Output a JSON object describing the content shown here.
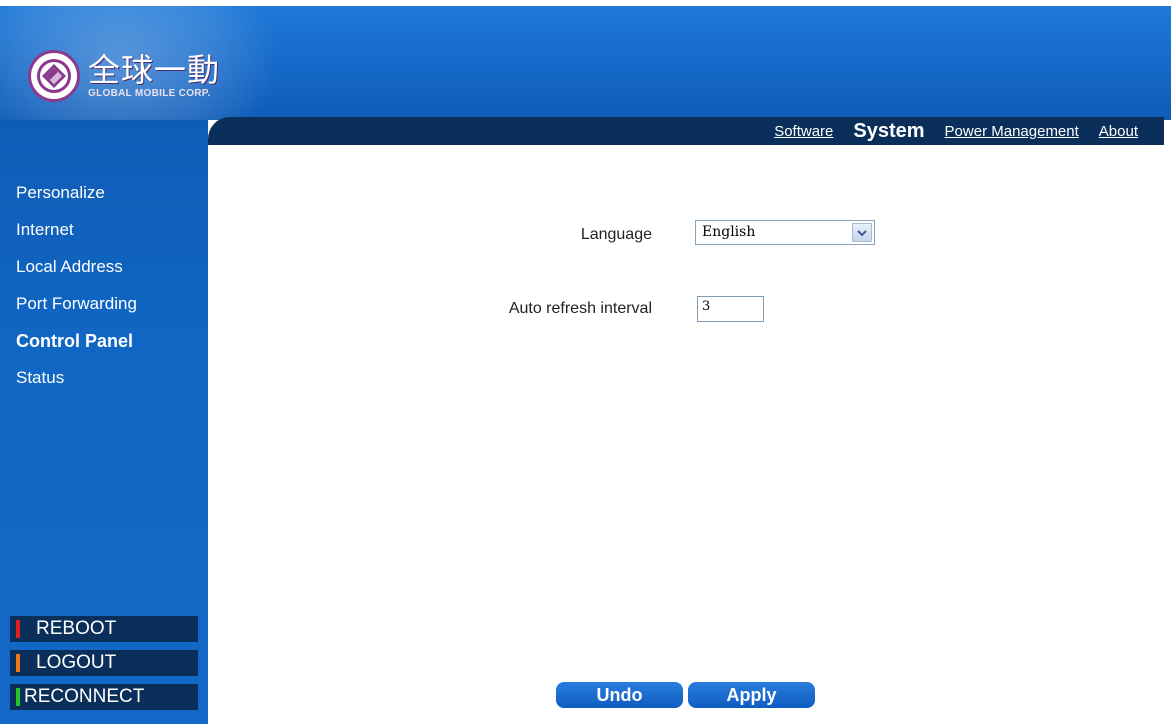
{
  "brand": {
    "name_cn": "全球一動",
    "name_en": "GLOBAL MOBILE CORP."
  },
  "tabs": [
    {
      "label": "Software",
      "active": false
    },
    {
      "label": "System",
      "active": true
    },
    {
      "label": "Power Management",
      "active": false
    },
    {
      "label": "About",
      "active": false
    }
  ],
  "sidebar": {
    "items": [
      {
        "label": "Personalize",
        "active": false
      },
      {
        "label": "Internet",
        "active": false
      },
      {
        "label": "Local Address",
        "active": false
      },
      {
        "label": "Port Forwarding",
        "active": false
      },
      {
        "label": "Control Panel",
        "active": true
      },
      {
        "label": "Status",
        "active": false
      }
    ],
    "actions": [
      {
        "label": "REBOOT",
        "color": "#e02020"
      },
      {
        "label": "LOGOUT",
        "color": "#f07a1a"
      },
      {
        "label": "RECONNECT",
        "color": "#22c22a"
      }
    ]
  },
  "form": {
    "language_label": "Language",
    "language_value": "English",
    "refresh_label": "Auto refresh interval",
    "refresh_value": "3"
  },
  "buttons": {
    "undo": "Undo",
    "apply": "Apply"
  },
  "colors": {
    "header_blue": "#1568c8",
    "navbar_dark": "#0a2f5a",
    "button_blue": "#0f5cc0"
  },
  "icons": {
    "logo": "logo-emblem-icon",
    "dropdown": "chevron-down-icon"
  }
}
